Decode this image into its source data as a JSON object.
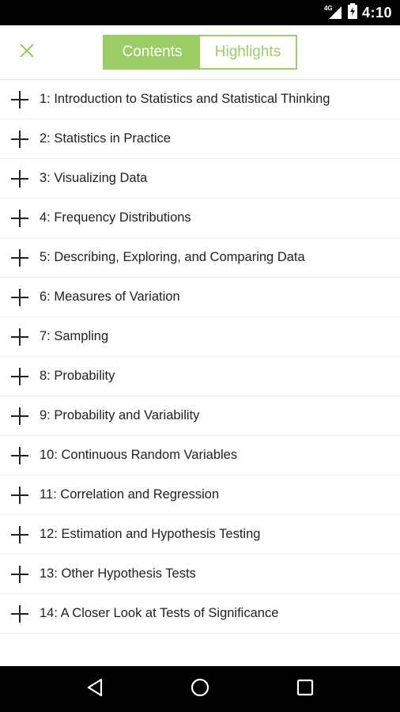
{
  "status_bar": {
    "time": "4:10",
    "network": "4G"
  },
  "header": {
    "tabs": [
      {
        "label": "Contents",
        "active": true
      },
      {
        "label": "Highlights",
        "active": false
      }
    ],
    "accent_color": "#9ccc65"
  },
  "toc": {
    "items": [
      {
        "label": "1: Introduction to Statistics and Statistical Thinking"
      },
      {
        "label": "2: Statistics in Practice"
      },
      {
        "label": "3: Visualizing Data"
      },
      {
        "label": "4: Frequency Distributions"
      },
      {
        "label": "5: Describing, Exploring, and Comparing Data"
      },
      {
        "label": "6: Measures of Variation"
      },
      {
        "label": "7: Sampling"
      },
      {
        "label": "8: Probability"
      },
      {
        "label": "9: Probability and Variability"
      },
      {
        "label": "10: Continuous Random Variables"
      },
      {
        "label": "11: Correlation and Regression"
      },
      {
        "label": "12: Estimation and Hypothesis Testing"
      },
      {
        "label": "13: Other Hypothesis Tests"
      },
      {
        "label": "14: A Closer Look at Tests of Significance"
      }
    ]
  },
  "icons": {
    "close": "close-icon",
    "expand": "plus-icon",
    "back": "back-triangle-icon",
    "home": "home-circle-icon",
    "recents": "recents-square-icon"
  }
}
